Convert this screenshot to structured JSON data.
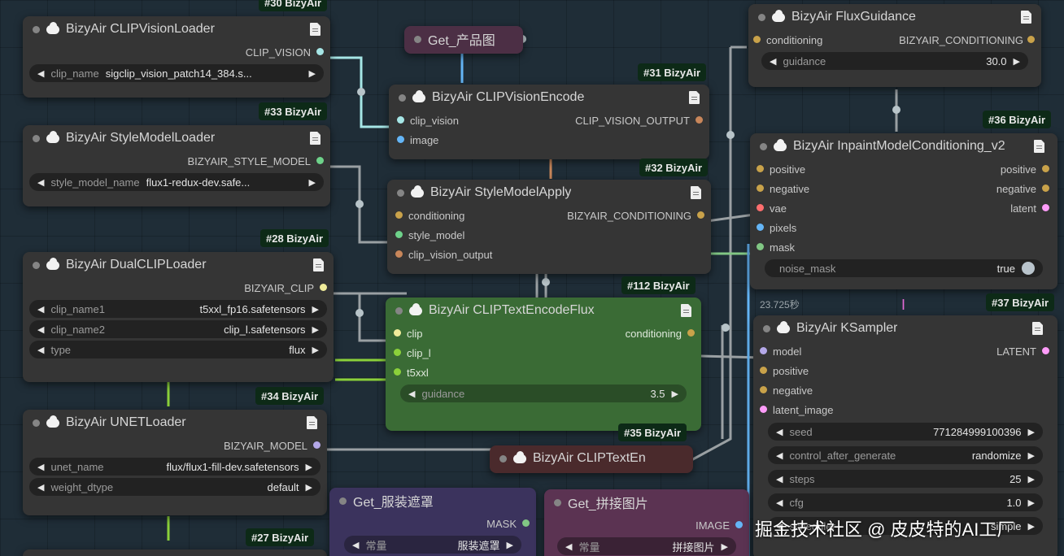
{
  "colors": {
    "canvas": "#1f2d37",
    "node": "#353535",
    "clip_vision": "#a6e6e6",
    "style_model": "#6ed28a",
    "clip": "#f0ec9a",
    "model": "#b4a8e8",
    "conditioning": "#c9a24a",
    "vae": "#ff6e6e",
    "latent": "#ff9cf9",
    "image": "#64b5f6",
    "mask": "#81c784",
    "badge": "#0d2a17"
  },
  "badges": {
    "b30": "#30 BizyAir",
    "b33": "#33 BizyAir",
    "b28": "#28 BizyAir",
    "b34": "#34 BizyAir",
    "b27": "#27 BizyAir",
    "b31": "#31 BizyAir",
    "b32": "#32 BizyAir",
    "b112": "#112 BizyAir",
    "b35": "#35 BizyAir",
    "b36": "#36 BizyAir",
    "b37": "#37 BizyAir"
  },
  "nodes": {
    "clip_vision_loader": {
      "title": "BizyAir CLIPVisionLoader",
      "output": "CLIP_VISION",
      "widget_label": "clip_name",
      "widget_value": "sigclip_vision_patch14_384.s..."
    },
    "style_model_loader": {
      "title": "BizyAir StyleModelLoader",
      "output": "BIZYAIR_STYLE_MODEL",
      "widget_label": "style_model_name",
      "widget_value": "flux1-redux-dev.safe..."
    },
    "dual_clip_loader": {
      "title": "BizyAir DualCLIPLoader",
      "output": "BIZYAIR_CLIP",
      "widgets": [
        {
          "label": "clip_name1",
          "value": "t5xxl_fp16.safetensors"
        },
        {
          "label": "clip_name2",
          "value": "clip_l.safetensors"
        },
        {
          "label": "type",
          "value": "flux"
        }
      ]
    },
    "unet_loader": {
      "title": "BizyAir UNETLoader",
      "output": "BIZYAIR_MODEL",
      "widgets": [
        {
          "label": "unet_name",
          "value": "flux/flux1-fill-dev.safetensors"
        },
        {
          "label": "weight_dtype",
          "value": "default"
        }
      ]
    },
    "get_product": {
      "title": "Get_产品图"
    },
    "clip_vision_encode": {
      "title": "BizyAir CLIPVisionEncode",
      "inputs": [
        "clip_vision",
        "image"
      ],
      "output": "CLIP_VISION_OUTPUT"
    },
    "style_model_apply": {
      "title": "BizyAir StyleModelApply",
      "inputs": [
        "conditioning",
        "style_model",
        "clip_vision_output"
      ],
      "output": "BIZYAIR_CONDITIONING"
    },
    "clip_text_encode_flux": {
      "title": "BizyAir CLIPTextEncodeFlux",
      "inputs": [
        "clip",
        "clip_l",
        "t5xxl"
      ],
      "output": "conditioning",
      "widget_label": "guidance",
      "widget_value": "3.5"
    },
    "clip_text_en": {
      "title": "BizyAir CLIPTextEn"
    },
    "get_mask": {
      "title": "Get_服装遮罩",
      "output": "MASK",
      "widget_label": "常量",
      "widget_value": "服装遮罩"
    },
    "get_stitch": {
      "title": "Get_拼接图片",
      "output": "IMAGE",
      "widget_label": "常量",
      "widget_value": "拼接图片"
    },
    "flux_guidance": {
      "title": "BizyAir FluxGuidance",
      "input": "conditioning",
      "output": "BIZYAIR_CONDITIONING",
      "widget_label": "guidance",
      "widget_value": "30.0"
    },
    "inpaint_conditioning": {
      "title": "BizyAir InpaintModelConditioning_v2",
      "inputs": [
        "positive",
        "negative",
        "vae",
        "pixels",
        "mask"
      ],
      "outputs": [
        "positive",
        "negative",
        "latent"
      ],
      "widget_label": "noise_mask",
      "widget_value": "true"
    },
    "ksampler": {
      "title": "BizyAir KSampler",
      "inputs": [
        "model",
        "positive",
        "negative",
        "latent_image"
      ],
      "output": "LATENT",
      "widgets": [
        {
          "label": "seed",
          "value": "771284999100396"
        },
        {
          "label": "control_after_generate",
          "value": "randomize"
        },
        {
          "label": "steps",
          "value": "25"
        },
        {
          "label": "cfg",
          "value": "1.0"
        },
        {
          "label": "scheduler",
          "value": "simple"
        }
      ]
    }
  },
  "timing": "23.725秒",
  "watermark": "掘金技术社区 @ 皮皮特的AI工厂"
}
